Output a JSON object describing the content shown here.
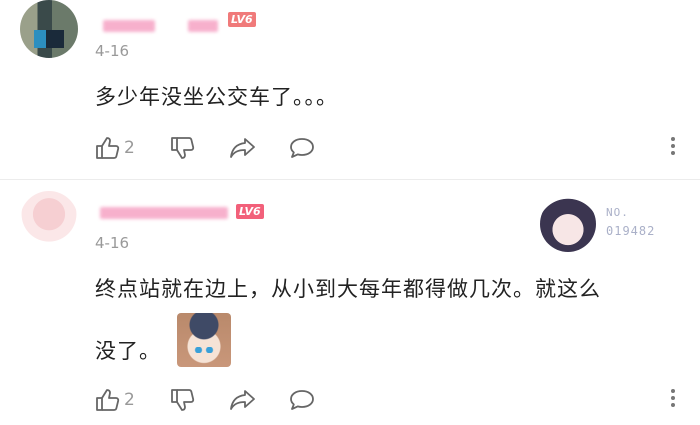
{
  "comments": [
    {
      "level_badge": "LV6",
      "date": "4-16",
      "text": "多少年没坐公交车了。。。",
      "like_count": "2",
      "colors": {
        "badge": "#f07a7a",
        "name": "#f6a3c4"
      }
    },
    {
      "level_badge": "LV6",
      "date": "4-16",
      "text_line1": "终点站就在边上，从小到大每年都得做几次。就这么",
      "text_line2": "没了。",
      "like_count": "2",
      "fan_badge": {
        "label": "NO.",
        "number": "019482"
      },
      "colors": {
        "badge": "#f2607a",
        "name": "#f6a3c4"
      }
    }
  ],
  "icons": [
    "thumb-up-icon",
    "thumb-down-icon",
    "share-icon",
    "reply-icon",
    "more-icon"
  ]
}
